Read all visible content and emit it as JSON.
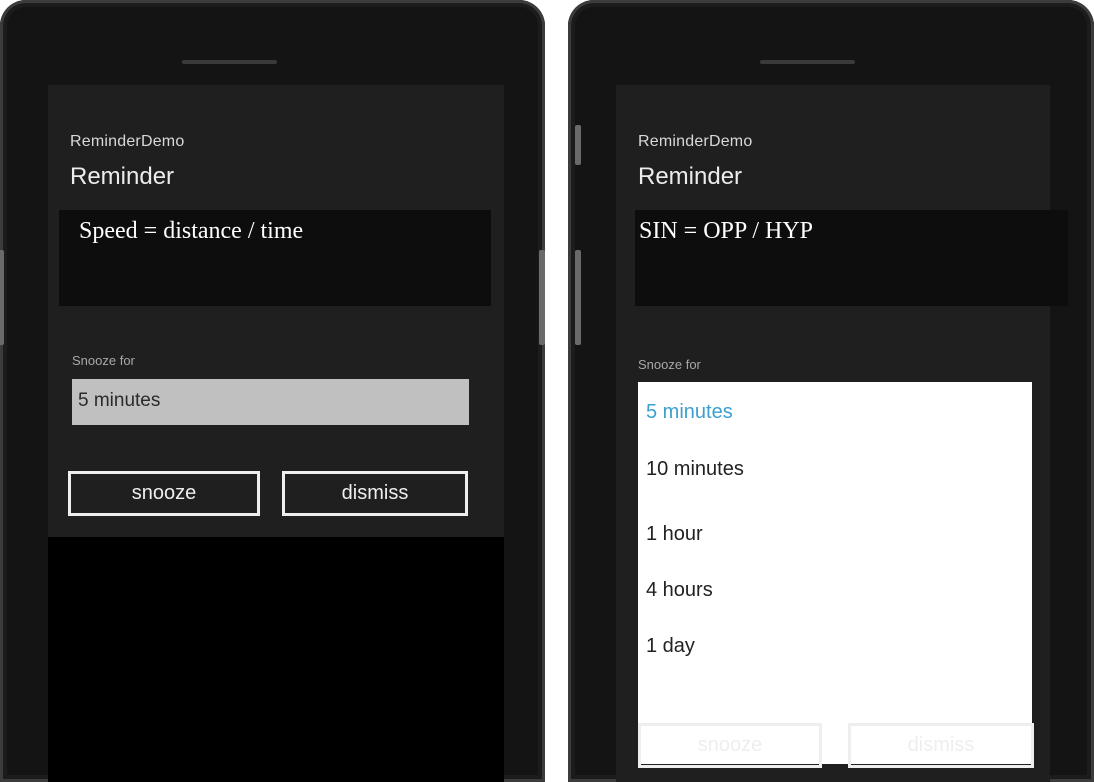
{
  "left": {
    "app_name": "ReminderDemo",
    "title": "Reminder",
    "content": "Speed = distance / time",
    "snooze_label": "Snooze for",
    "snooze_value": "5 minutes",
    "snooze_button": "snooze",
    "dismiss_button": "dismiss"
  },
  "right": {
    "app_name": "ReminderDemo",
    "title": "Reminder",
    "content": "SIN = OPP / HYP",
    "snooze_label": "Snooze for",
    "options": [
      "5 minutes",
      "10 minutes",
      "1 hour",
      "4 hours",
      "1 day"
    ],
    "selected_option": "5 minutes",
    "snooze_button": "snooze",
    "dismiss_button": "dismiss"
  },
  "colors": {
    "accent": "#3d9fd0",
    "dialog_background": "#1f1f1f",
    "screen_background": "#000000",
    "picker_background": "#c0c0c0"
  }
}
